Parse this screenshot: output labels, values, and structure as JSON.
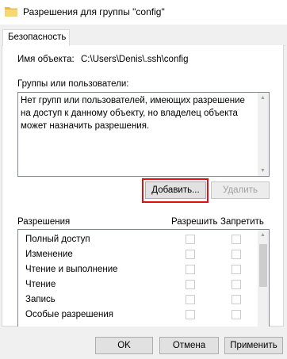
{
  "window": {
    "title": "Разрешения для группы \"config\""
  },
  "tabs": [
    {
      "label": "Безопасность"
    }
  ],
  "object": {
    "label": "Имя объекта:",
    "value": "C:\\Users\\Denis\\.ssh\\config"
  },
  "groups": {
    "label": "Группы или пользователи:",
    "message": "Нет групп или пользователей, имеющих разрешение на доступ к данному объекту, но владелец объекта может назначить разрешения."
  },
  "buttons": {
    "add": "Добавить...",
    "remove": "Удалить",
    "ok": "OK",
    "cancel": "Отмена",
    "apply": "Применить"
  },
  "permissions": {
    "header": "Разрешения",
    "allow_header": "Разрешить",
    "deny_header": "Запретить",
    "rows": [
      {
        "name": "Полный доступ"
      },
      {
        "name": "Изменение"
      },
      {
        "name": "Чтение и выполнение"
      },
      {
        "name": "Чтение"
      },
      {
        "name": "Запись"
      },
      {
        "name": "Особые разрешения"
      }
    ]
  },
  "icons": {
    "title": "folder-icon",
    "scroll_up": "chevron-up-icon",
    "scroll_down": "chevron-down-icon"
  }
}
